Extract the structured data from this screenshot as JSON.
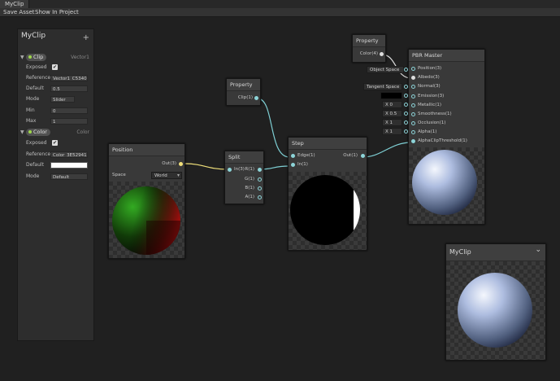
{
  "window": {
    "tab_title": "MyClip"
  },
  "toolbar": {
    "save_label": "Save Asset",
    "show_label": "Show In Project"
  },
  "blackboard": {
    "title": "MyClip",
    "add_symbol": "+",
    "properties": [
      {
        "name": "Clip",
        "type": "Vector1",
        "exposed_label": "Exposed",
        "exposed_check": "✔",
        "reference_label": "Reference",
        "reference_value": "Vector1_C53409",
        "default_label": "Default",
        "default_value": "0.5",
        "mode_label": "Mode",
        "mode_value": "Slider",
        "min_label": "Min",
        "min_value": "0",
        "max_label": "Max",
        "max_value": "1"
      },
      {
        "name": "Color",
        "type": "Color",
        "exposed_label": "Exposed",
        "exposed_check": "✔",
        "reference_label": "Reference",
        "reference_value": "Color_3E529413",
        "default_label": "Default",
        "default_color": "#ffffff",
        "mode_label": "Mode",
        "mode_value": "Default"
      }
    ]
  },
  "nodes": {
    "position": {
      "title": "Position",
      "out": "Out(3)",
      "space_label": "Space",
      "space_value": "World"
    },
    "split": {
      "title": "Split",
      "in": "In(3)",
      "outs": [
        "R(1)",
        "G(1)",
        "B(1)",
        "A(1)"
      ]
    },
    "property_clip": {
      "title": "Property",
      "out": "Clip(1)"
    },
    "property_color": {
      "title": "Property",
      "out": "Color(4)"
    },
    "step": {
      "title": "Step",
      "in1": "Edge(1)",
      "in2": "In(1)",
      "out": "Out(1)"
    },
    "pbr": {
      "title": "PBR Master",
      "position_space": "Object Space",
      "normal_space": "Tangent Space",
      "ports": [
        "Position(3)",
        "Albedo(3)",
        "Normal(3)",
        "Emission(3)",
        "Metallic(1)",
        "Smoothness(1)",
        "Occlusion(1)",
        "Alpha(1)",
        "AlphaClipThreshold(1)"
      ],
      "metallic_value": "X 0",
      "smoothness_value": "X 0.5",
      "occlusion_value": "X 1",
      "alpha_value": "X 1"
    }
  },
  "preview": {
    "title": "MyClip",
    "chevron": "⌄"
  },
  "colors": {
    "wire_cyan": "#7ecfd4",
    "wire_yellow": "#f0e07a",
    "node_bg": "#393939"
  }
}
